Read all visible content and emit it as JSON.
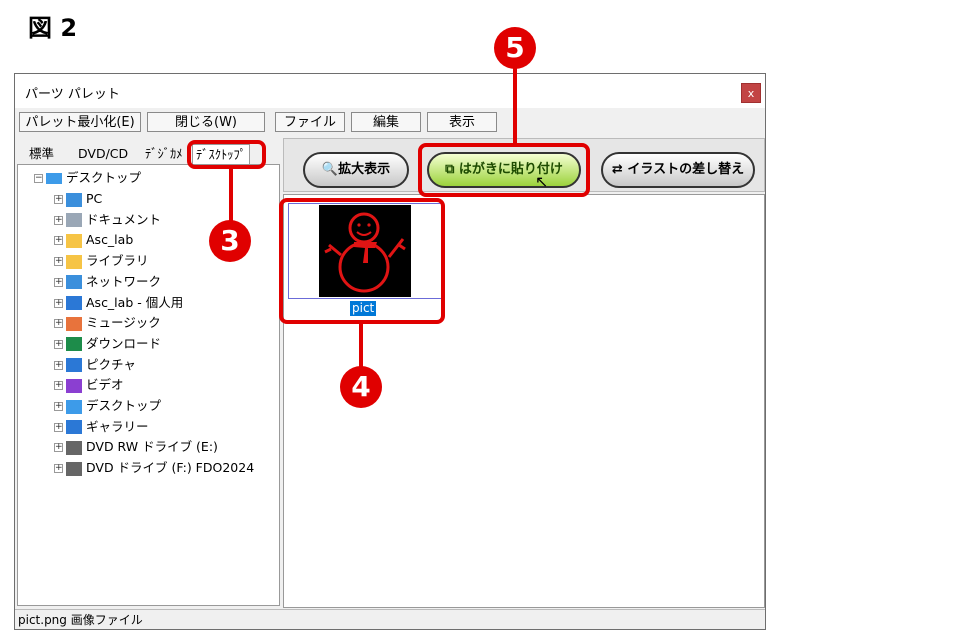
{
  "figure_label": "図 2",
  "window": {
    "title": "パーツ パレット",
    "close_label": "x"
  },
  "menu": [
    {
      "label": "パレット最小化(E)"
    },
    {
      "label": "閉じる(W)"
    },
    {
      "label": "ファイル"
    },
    {
      "label": "編集"
    },
    {
      "label": "表示"
    }
  ],
  "tabs": [
    {
      "label": "標準"
    },
    {
      "label": "DVD/CD"
    },
    {
      "label": "ﾃﾞｼﾞｶﾒ"
    },
    {
      "label": "ﾃﾞｽｸﾄｯﾌﾟ",
      "active": true
    }
  ],
  "tree": {
    "root": "デスクトップ",
    "items": [
      {
        "label": "PC",
        "icon": "monitor-icon"
      },
      {
        "label": "ドキュメント",
        "icon": "document-icon"
      },
      {
        "label": "Asc_lab",
        "icon": "folder-icon"
      },
      {
        "label": "ライブラリ",
        "icon": "folder-icon"
      },
      {
        "label": "ネットワーク",
        "icon": "network-icon"
      },
      {
        "label": "Asc_lab - 個人用",
        "icon": "cloud-icon"
      },
      {
        "label": "ミュージック",
        "icon": "music-icon"
      },
      {
        "label": "ダウンロード",
        "icon": "download-icon"
      },
      {
        "label": "ピクチャ",
        "icon": "picture-icon"
      },
      {
        "label": "ビデオ",
        "icon": "video-icon"
      },
      {
        "label": "デスクトップ",
        "icon": "desktop-icon"
      },
      {
        "label": "ギャラリー",
        "icon": "gallery-icon"
      },
      {
        "label": "DVD RW ドライブ (E:)",
        "icon": "dvd-drive-icon"
      },
      {
        "label": "DVD ドライブ (F:) FDO2024",
        "icon": "dvd-drive-icon"
      }
    ]
  },
  "toolbar": {
    "zoom_label": "拡大表示",
    "paste_label": "はがきに貼り付け",
    "replace_label": "イラストの差し替え"
  },
  "thumbnail": {
    "filename": "pict"
  },
  "statusbar": {
    "text": "pict.png 画像ファイル"
  },
  "callouts": [
    {
      "number": "3"
    },
    {
      "number": "4"
    },
    {
      "number": "5"
    }
  ],
  "colors": {
    "callout": "#e00000",
    "selection": "#0078d7"
  }
}
